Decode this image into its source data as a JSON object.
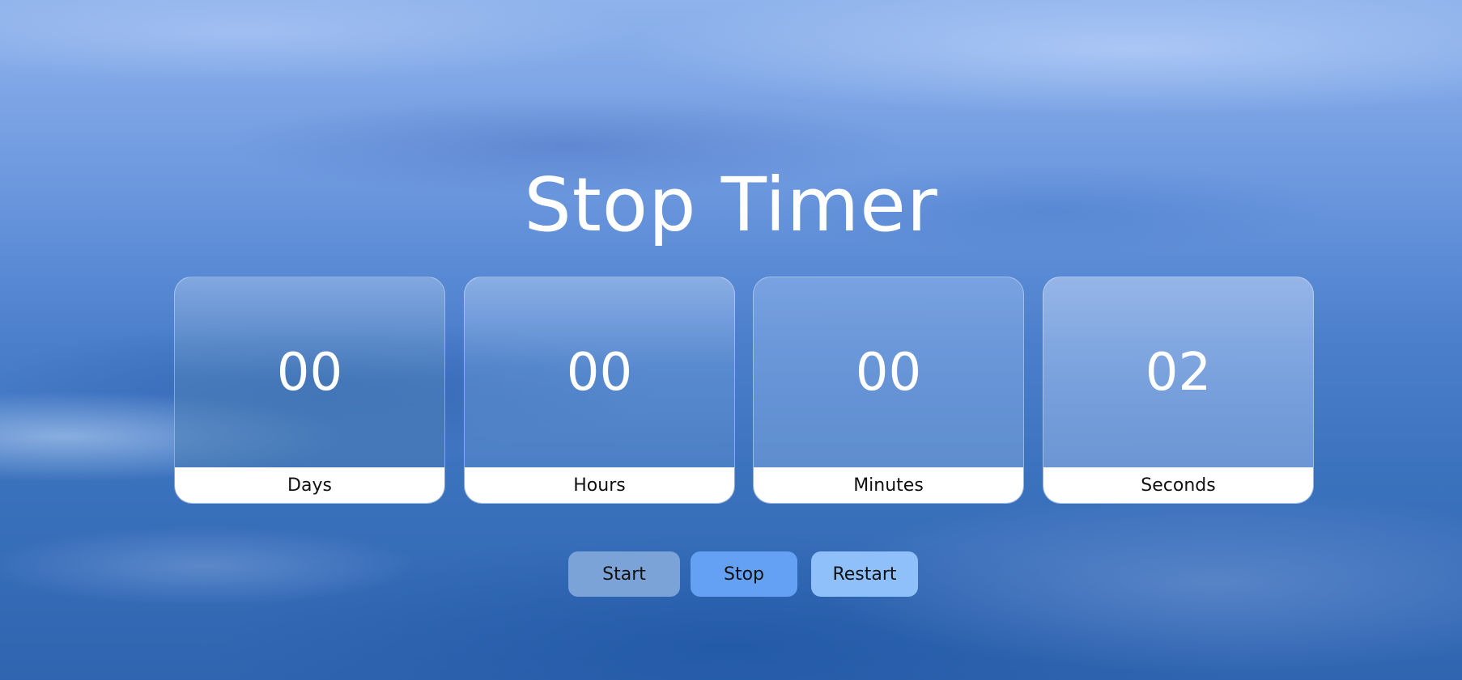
{
  "title": "Stop Timer",
  "timer": {
    "units": [
      {
        "value": "00",
        "label": "Days"
      },
      {
        "value": "00",
        "label": "Hours"
      },
      {
        "value": "00",
        "label": "Minutes"
      },
      {
        "value": "02",
        "label": "Seconds"
      }
    ]
  },
  "controls": {
    "start_label": "Start",
    "stop_label": "Stop",
    "restart_label": "Restart"
  },
  "colors": {
    "start_button": "#7ba3d8",
    "stop_button": "#64a0f4",
    "restart_button": "#8fc0fa",
    "text_light": "#ffffff"
  }
}
